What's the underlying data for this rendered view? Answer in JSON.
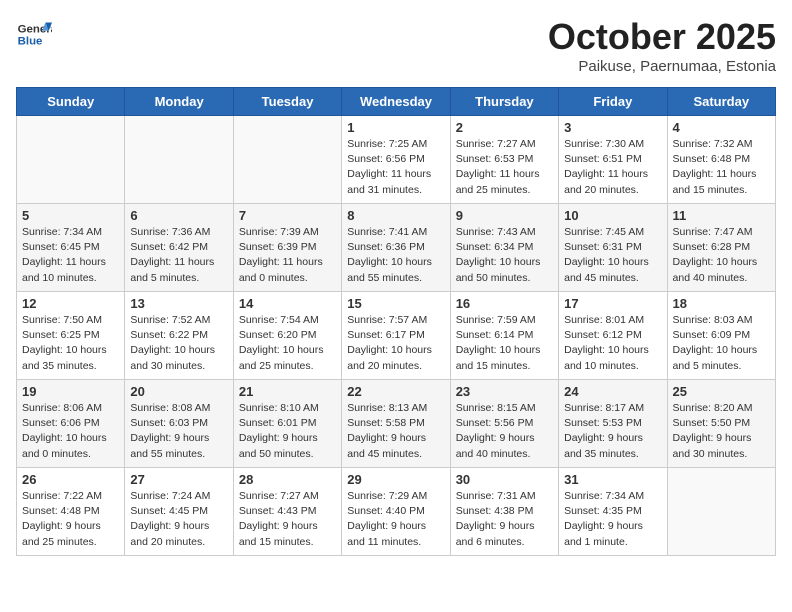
{
  "header": {
    "logo_line1": "General",
    "logo_line2": "Blue",
    "month": "October 2025",
    "location": "Paikuse, Paernumaa, Estonia"
  },
  "weekdays": [
    "Sunday",
    "Monday",
    "Tuesday",
    "Wednesday",
    "Thursday",
    "Friday",
    "Saturday"
  ],
  "weeks": [
    [
      {
        "day": "",
        "info": ""
      },
      {
        "day": "",
        "info": ""
      },
      {
        "day": "",
        "info": ""
      },
      {
        "day": "1",
        "info": "Sunrise: 7:25 AM\nSunset: 6:56 PM\nDaylight: 11 hours\nand 31 minutes."
      },
      {
        "day": "2",
        "info": "Sunrise: 7:27 AM\nSunset: 6:53 PM\nDaylight: 11 hours\nand 25 minutes."
      },
      {
        "day": "3",
        "info": "Sunrise: 7:30 AM\nSunset: 6:51 PM\nDaylight: 11 hours\nand 20 minutes."
      },
      {
        "day": "4",
        "info": "Sunrise: 7:32 AM\nSunset: 6:48 PM\nDaylight: 11 hours\nand 15 minutes."
      }
    ],
    [
      {
        "day": "5",
        "info": "Sunrise: 7:34 AM\nSunset: 6:45 PM\nDaylight: 11 hours\nand 10 minutes."
      },
      {
        "day": "6",
        "info": "Sunrise: 7:36 AM\nSunset: 6:42 PM\nDaylight: 11 hours\nand 5 minutes."
      },
      {
        "day": "7",
        "info": "Sunrise: 7:39 AM\nSunset: 6:39 PM\nDaylight: 11 hours\nand 0 minutes."
      },
      {
        "day": "8",
        "info": "Sunrise: 7:41 AM\nSunset: 6:36 PM\nDaylight: 10 hours\nand 55 minutes."
      },
      {
        "day": "9",
        "info": "Sunrise: 7:43 AM\nSunset: 6:34 PM\nDaylight: 10 hours\nand 50 minutes."
      },
      {
        "day": "10",
        "info": "Sunrise: 7:45 AM\nSunset: 6:31 PM\nDaylight: 10 hours\nand 45 minutes."
      },
      {
        "day": "11",
        "info": "Sunrise: 7:47 AM\nSunset: 6:28 PM\nDaylight: 10 hours\nand 40 minutes."
      }
    ],
    [
      {
        "day": "12",
        "info": "Sunrise: 7:50 AM\nSunset: 6:25 PM\nDaylight: 10 hours\nand 35 minutes."
      },
      {
        "day": "13",
        "info": "Sunrise: 7:52 AM\nSunset: 6:22 PM\nDaylight: 10 hours\nand 30 minutes."
      },
      {
        "day": "14",
        "info": "Sunrise: 7:54 AM\nSunset: 6:20 PM\nDaylight: 10 hours\nand 25 minutes."
      },
      {
        "day": "15",
        "info": "Sunrise: 7:57 AM\nSunset: 6:17 PM\nDaylight: 10 hours\nand 20 minutes."
      },
      {
        "day": "16",
        "info": "Sunrise: 7:59 AM\nSunset: 6:14 PM\nDaylight: 10 hours\nand 15 minutes."
      },
      {
        "day": "17",
        "info": "Sunrise: 8:01 AM\nSunset: 6:12 PM\nDaylight: 10 hours\nand 10 minutes."
      },
      {
        "day": "18",
        "info": "Sunrise: 8:03 AM\nSunset: 6:09 PM\nDaylight: 10 hours\nand 5 minutes."
      }
    ],
    [
      {
        "day": "19",
        "info": "Sunrise: 8:06 AM\nSunset: 6:06 PM\nDaylight: 10 hours\nand 0 minutes."
      },
      {
        "day": "20",
        "info": "Sunrise: 8:08 AM\nSunset: 6:03 PM\nDaylight: 9 hours\nand 55 minutes."
      },
      {
        "day": "21",
        "info": "Sunrise: 8:10 AM\nSunset: 6:01 PM\nDaylight: 9 hours\nand 50 minutes."
      },
      {
        "day": "22",
        "info": "Sunrise: 8:13 AM\nSunset: 5:58 PM\nDaylight: 9 hours\nand 45 minutes."
      },
      {
        "day": "23",
        "info": "Sunrise: 8:15 AM\nSunset: 5:56 PM\nDaylight: 9 hours\nand 40 minutes."
      },
      {
        "day": "24",
        "info": "Sunrise: 8:17 AM\nSunset: 5:53 PM\nDaylight: 9 hours\nand 35 minutes."
      },
      {
        "day": "25",
        "info": "Sunrise: 8:20 AM\nSunset: 5:50 PM\nDaylight: 9 hours\nand 30 minutes."
      }
    ],
    [
      {
        "day": "26",
        "info": "Sunrise: 7:22 AM\nSunset: 4:48 PM\nDaylight: 9 hours\nand 25 minutes."
      },
      {
        "day": "27",
        "info": "Sunrise: 7:24 AM\nSunset: 4:45 PM\nDaylight: 9 hours\nand 20 minutes."
      },
      {
        "day": "28",
        "info": "Sunrise: 7:27 AM\nSunset: 4:43 PM\nDaylight: 9 hours\nand 15 minutes."
      },
      {
        "day": "29",
        "info": "Sunrise: 7:29 AM\nSunset: 4:40 PM\nDaylight: 9 hours\nand 11 minutes."
      },
      {
        "day": "30",
        "info": "Sunrise: 7:31 AM\nSunset: 4:38 PM\nDaylight: 9 hours\nand 6 minutes."
      },
      {
        "day": "31",
        "info": "Sunrise: 7:34 AM\nSunset: 4:35 PM\nDaylight: 9 hours\nand 1 minute."
      },
      {
        "day": "",
        "info": ""
      }
    ]
  ]
}
